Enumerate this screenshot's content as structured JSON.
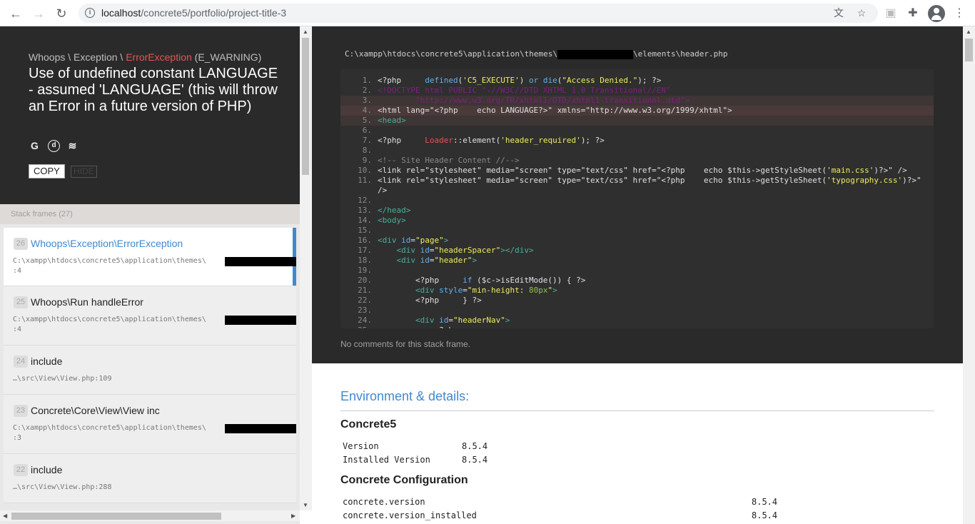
{
  "browser": {
    "url_host": "localhost",
    "url_path": "/concrete5/portfolio/project-title-3"
  },
  "exception": {
    "class_prefix": "Whoops \\ Exception \\ ",
    "class_name": "ErrorException",
    "class_suffix": " (E_WARNING)",
    "message": "Use of undefined constant LANGUAGE - assumed 'LANGUAGE' (this will throw an Error in a future version of PHP)",
    "copy_label": "COPY",
    "hide_label": "HIDE"
  },
  "stack": {
    "header": "Stack frames (27)",
    "frames": [
      {
        "index": "26",
        "class": "Whoops\\Exception\\ErrorException",
        "file": "C:\\xampp\\htdocs\\concrete5\\application\\themes\\",
        "line": ":4"
      },
      {
        "index": "25",
        "class": "Whoops\\Run handleError",
        "file": "C:\\xampp\\htdocs\\concrete5\\application\\themes\\",
        "line": ":4"
      },
      {
        "index": "24",
        "class": "include",
        "file": "…\\src\\View\\View.php:109",
        "line": ""
      },
      {
        "index": "23",
        "class": "Concrete\\Core\\View\\View inc",
        "file": "C:\\xampp\\htdocs\\concrete5\\application\\themes\\",
        "line": ":3"
      },
      {
        "index": "22",
        "class": "include",
        "file": "…\\src\\View\\View.php:288",
        "line": ""
      }
    ]
  },
  "code": {
    "path_prefix": "C:\\xampp\\htdocs\\concrete5\\application\\themes\\",
    "path_suffix": "\\elements\\header.php",
    "no_comments": "No comments for this stack frame."
  },
  "details": {
    "title": "Environment & details:",
    "concrete5": {
      "title": "Concrete5",
      "rows": [
        {
          "key": "Version",
          "value": "8.5.4"
        },
        {
          "key": "Installed Version",
          "value": "8.5.4"
        }
      ]
    },
    "config": {
      "title": "Concrete Configuration",
      "rows": [
        {
          "key": "concrete.version",
          "value": "8.5.4"
        },
        {
          "key": "concrete.version_installed",
          "value": "8.5.4"
        }
      ]
    }
  },
  "colors": {
    "accent": "#4288ce",
    "error_red": "#e95353",
    "dark_bg": "#2a2a2a"
  }
}
